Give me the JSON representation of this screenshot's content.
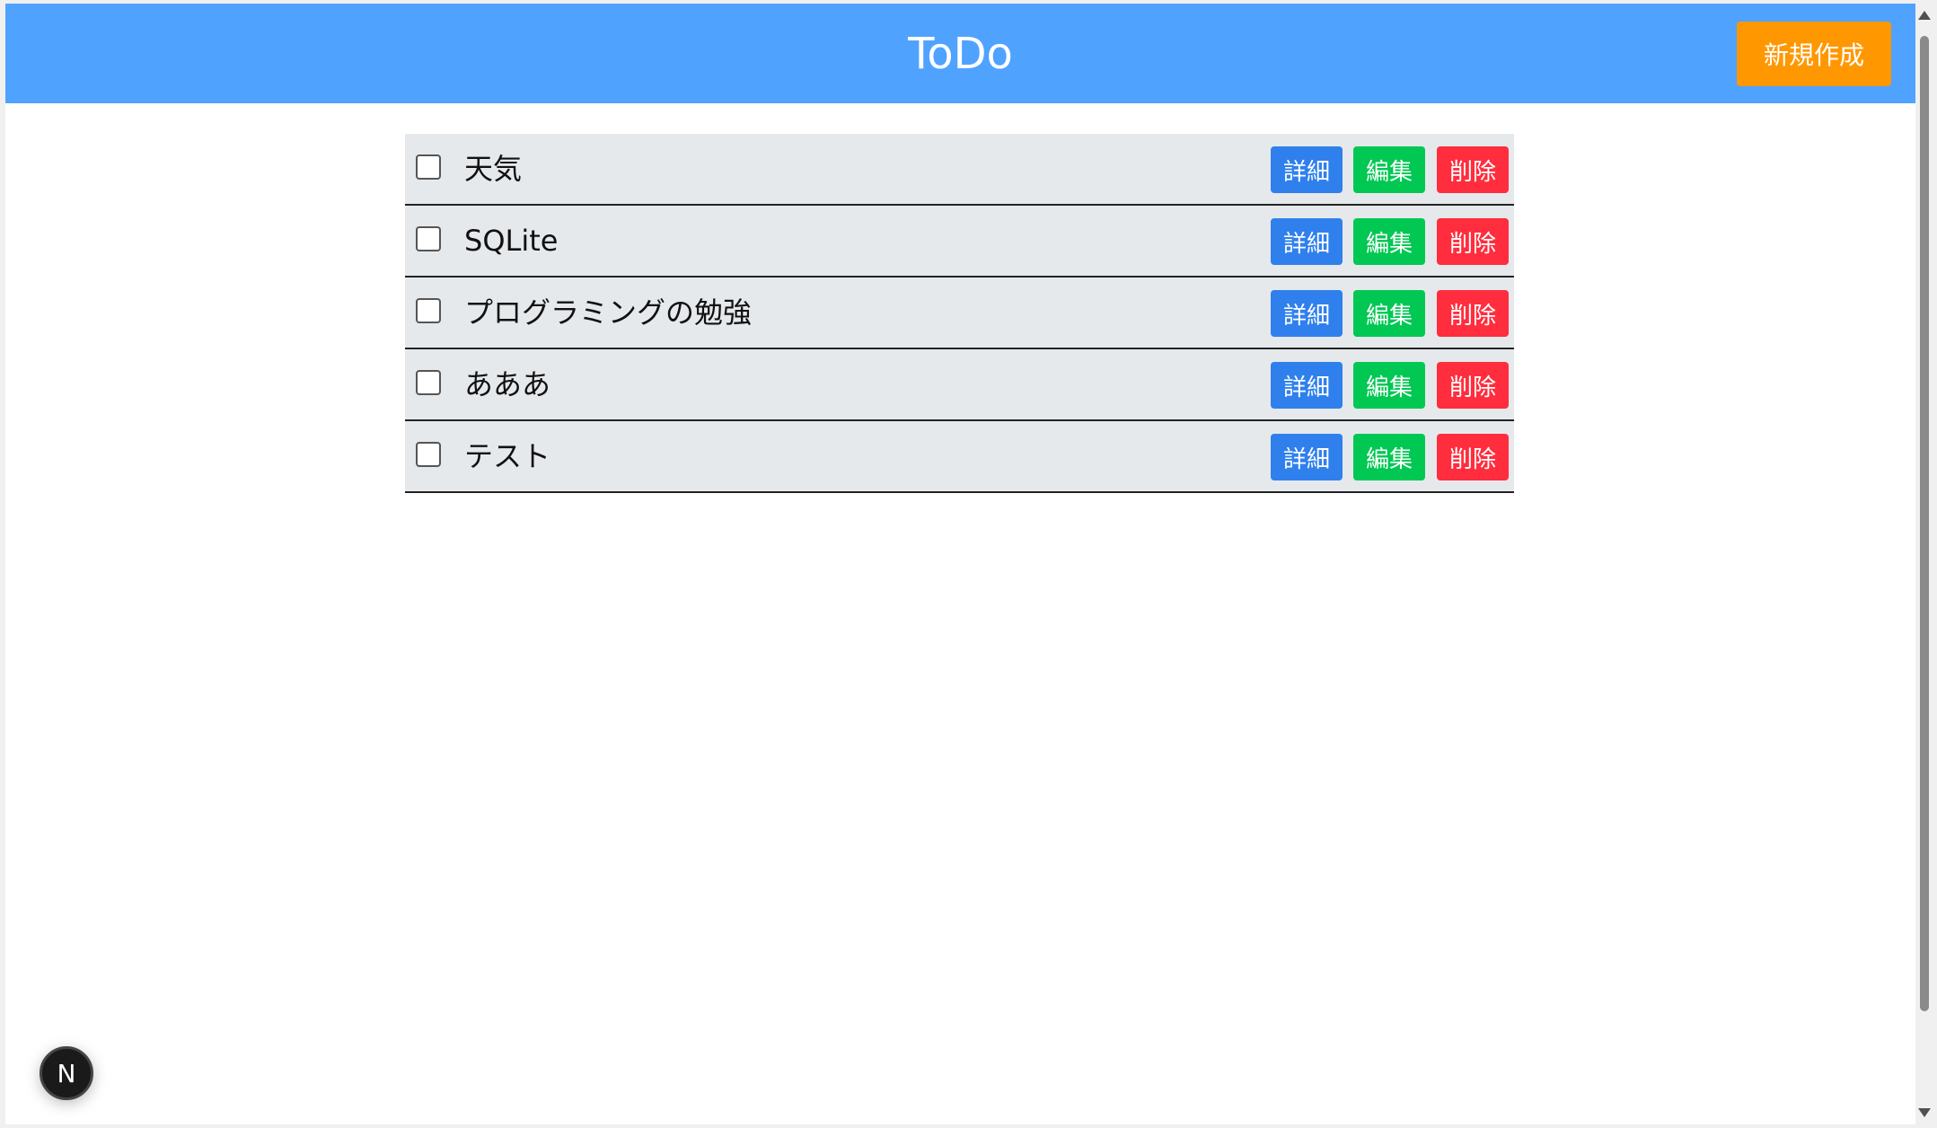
{
  "header": {
    "title": "ToDo",
    "new_button_label": "新規作成",
    "background_color": "#4fa3ff",
    "new_button_color": "#ff9800"
  },
  "todos": [
    {
      "title": "天気",
      "checked": false
    },
    {
      "title": "SQLite",
      "checked": false
    },
    {
      "title": "プログラミングの勉強",
      "checked": false
    },
    {
      "title": "あああ",
      "checked": false
    },
    {
      "title": "テスト",
      "checked": false
    }
  ],
  "actions": {
    "detail_label": "詳細",
    "edit_label": "編集",
    "delete_label": "削除",
    "detail_color": "#2f80ed",
    "edit_color": "#00c853",
    "delete_color": "#ff2d3d"
  },
  "dev_badge": {
    "label": "N",
    "icon": "nextjs-icon"
  }
}
